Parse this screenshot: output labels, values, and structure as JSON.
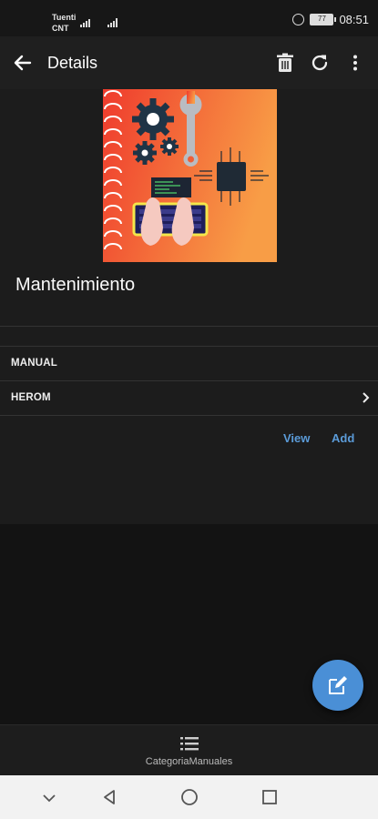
{
  "status_bar": {
    "carrier_line1": "Tuenti",
    "carrier_line2": "CNT",
    "battery": "77",
    "time": "08:51"
  },
  "app_bar": {
    "title": "Details",
    "icons": [
      "back-arrow-icon",
      "trash-icon",
      "refresh-icon",
      "more-vert-icon"
    ]
  },
  "item": {
    "name": "Mantenimiento"
  },
  "rows": [
    {
      "label": "MANUAL"
    },
    {
      "label": "HEROM"
    }
  ],
  "actions": {
    "view_label": "View",
    "add_label": "Add"
  },
  "bottom_nav": {
    "label": "CategoriaManuales",
    "icon": "list-icon"
  },
  "colors": {
    "accent": "#4a8fd6",
    "link": "#5b9bd8",
    "background": "#1c1c1c",
    "hero_gradient_start": "#f0432f",
    "hero_gradient_end": "#f79a45"
  }
}
